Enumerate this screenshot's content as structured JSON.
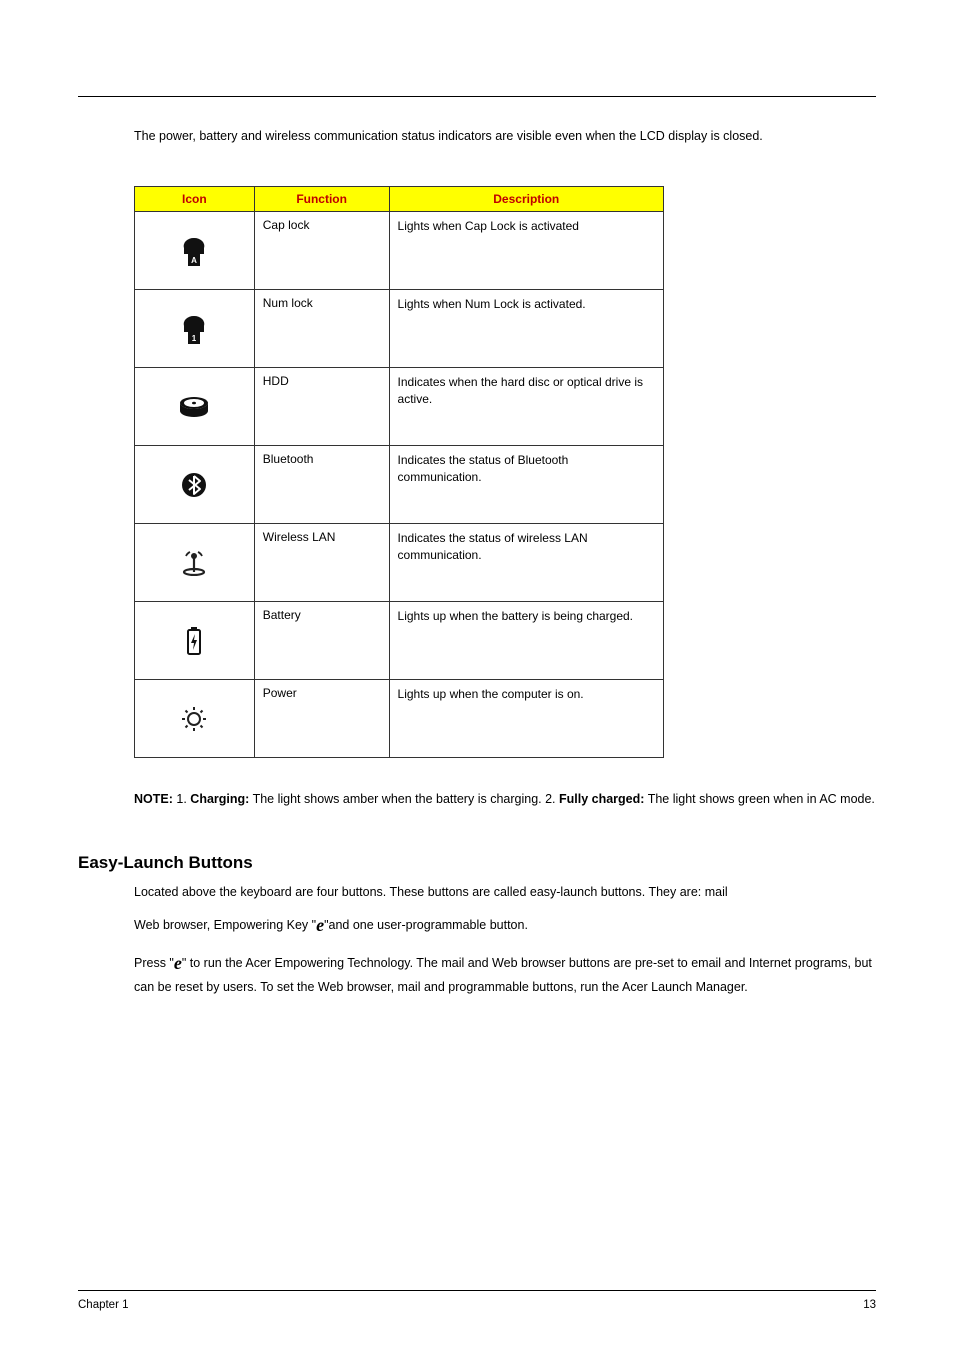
{
  "intro": "The power, battery and wireless communication status indicators are visible even when the LCD display is closed.",
  "table": {
    "headers": [
      "Icon",
      "Function",
      "Description"
    ],
    "rows": [
      {
        "icon": "caps-lock-icon",
        "function": "Cap lock",
        "description": "Lights when Cap Lock is activated"
      },
      {
        "icon": "num-lock-icon",
        "function": "Num lock",
        "description": "Lights when Num Lock is activated."
      },
      {
        "icon": "hdd-icon",
        "function": "HDD",
        "description": "Indicates when the hard disc or optical drive is active."
      },
      {
        "icon": "bluetooth-icon",
        "function": "Bluetooth",
        "description": "Indicates the status of Bluetooth communication."
      },
      {
        "icon": "wireless-lan-icon",
        "function": "Wireless LAN",
        "description": "Indicates the status of wireless LAN communication."
      },
      {
        "icon": "battery-icon",
        "function": "Battery",
        "description": "Lights up when the battery is being charged."
      },
      {
        "icon": "power-icon",
        "function": "Power",
        "description": "Lights up when the computer is on."
      }
    ]
  },
  "note": {
    "label": "NOTE:",
    "pref1": "1.",
    "strong1": "Charging:",
    "text1": "The light shows amber when the battery is charging. 2.",
    "strong2": "Fully charged:",
    "text2": "The light shows green when in AC mode."
  },
  "section_heading": "Easy-Launch Buttons",
  "easy_launch": {
    "p1": "Located above the keyboard are four buttons. These buttons are called easy-launch buttons. They are: mail",
    "p2a": "Web browser, Empowering Key \"",
    "p2b": "\"and one user-programmable button.",
    "p3a": "Press \"",
    "p3b": "\" to run the Acer Empowering Technology. The mail and Web browser buttons are pre-set to email and Internet programs, but can be reset by users. To set the Web browser, mail and programmable buttons, run the Acer Launch Manager."
  },
  "e_key": "e",
  "footer": {
    "left": "Chapter 1",
    "right": "13"
  }
}
